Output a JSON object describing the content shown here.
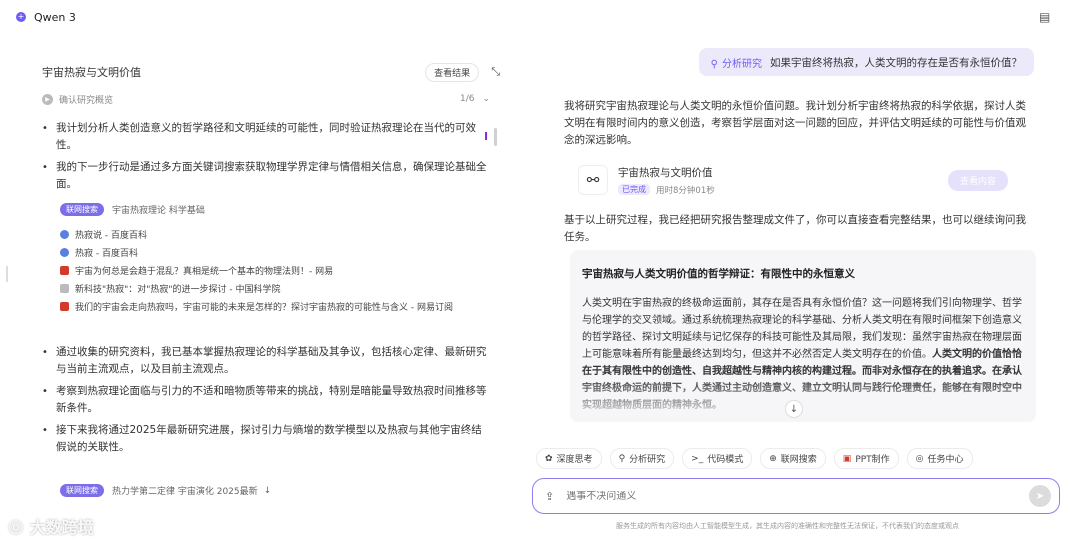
{
  "app": {
    "name": "Qwen 3"
  },
  "left_panel": {
    "title": "宇宙热寂与文明价值",
    "view_result_label": "查看结果",
    "confirm_row": {
      "label": "确认研究概览",
      "page_count": "1/6"
    },
    "bullets": [
      "我计划分析人类创造意义的哲学路径和文明延续的可能性，同时验证热寂理论在当代的可效性。",
      "我的下一步行动是通过多方面关键词搜索获取物理学界定律与情借相关信息，确保理论基础全面。"
    ],
    "search_block": {
      "tag": "联网搜索",
      "query": "宇宙热寂理论 科学基础",
      "sources": [
        {
          "icon": "globe-icon",
          "color": "#5b7fe0",
          "text": "热寂说 - 百度百科"
        },
        {
          "icon": "globe-icon",
          "color": "#5b7fe0",
          "text": "热寂 - 百度百科"
        },
        {
          "icon": "pin-icon",
          "color": "#d33a2c",
          "text": "宇宙为何总是会趋于混乱？真相是统一个基本的物理法则！- 网易"
        },
        {
          "icon": "link-icon",
          "color": "#888888",
          "text": "新科技\"热寂\"：对\"热寂\"的进一步探讨 - 中国科学院"
        },
        {
          "icon": "pin-icon",
          "color": "#d33a2c",
          "text": "我们的宇宙会走向热寂吗，宇宙可能的未来是怎样的？探讨宇宙热寂的可能性与含义 - 网易订阅"
        }
      ]
    },
    "bullets2": [
      "通过收集的研究资料，我已基本掌握热寂理论的科学基础及其争议，包括核心定律、最新研究与当前主流观点，以及目前主流观点。",
      "考察到热寂理论面临与引力的不适和暗物质等带来的挑战，特别是暗能量导致热寂时间推移等新条件。",
      "接下来我将通过2025年最新研究进展，探讨引力与熵增的数学模型以及热寂与其他宇宙终结假说的关联性。"
    ],
    "bottom_search": {
      "tag": "联网搜索",
      "query": "热力学第二定律 宇宙演化 2025最新"
    }
  },
  "right_panel": {
    "user_message": {
      "tag": "分析研究",
      "text": "如果宇宙终将热寂，人类文明的存在是否有永恒价值？"
    },
    "assistant_intro": "我将研究宇宙热寂理论与人类文明的永恒价值问题。我计划分析宇宙终将热寂的科学依据，探讨人类文明在有限时间内的意义创造，考察哲学层面对这一问题的回应，并评估文明延续的可能性与价值观念的深远影响。",
    "doc_card": {
      "title": "宇宙热寂与文明价值",
      "status": "已完成",
      "meta": "用时8分钟01秒",
      "view_label": "查看内容"
    },
    "assistant_followup": "基于以上研究过程，我已经把研究报告整理成文件了，你可以直接查看完整结果，也可以继续询问我任务。",
    "doc_preview": {
      "title": "宇宙热寂与人类文明价值的哲学辩证：有限性中的永恒意义",
      "body_p1": "人类文明在宇宙热寂的终极命运面前，其存在是否具有永恒价值？这一问题将我们引向物理学、哲学与伦理学的交叉领域。通过系统梳理热寂理论的科学基础、分析人类文明在有限时间框架下创造意义的哲学路径、探讨文明延续与记忆保存的科技可能性及其局限，我们发现：虽然宇宙热寂在物理层面上可能意味着所有能量最终达到均匀，但这并不必然否定人类文明存在的价值。",
      "body_p2": "人类文明的价值恰恰在于其有限性中的创造性、自我超越性与精神内核的构建过程。而非对永恒存在的执着追求。在承认宇宙终极命运的前提下，人类通过主动创造意义、建立文明认同与践行伦理责任，能够在有限时空中实现超越物质层面的精神永恒。"
    },
    "chips": [
      {
        "icon": "✿",
        "label": "深度思考"
      },
      {
        "icon": "⚲",
        "label": "分析研究"
      },
      {
        "icon": ">_",
        "label": "代码模式"
      },
      {
        "icon": "⊕",
        "label": "联网搜索"
      },
      {
        "icon": "▣",
        "label": "PPT制作"
      },
      {
        "icon": "◎",
        "label": "任务中心"
      }
    ],
    "input": {
      "placeholder": "遇事不决问通义"
    },
    "disclaimer": "服务生成的所有内容均由人工智能模型生成，其生成内容的准确性和完整性无法保证，不代表我们的态度或观点"
  },
  "watermark": {
    "text": "大数跨境"
  }
}
